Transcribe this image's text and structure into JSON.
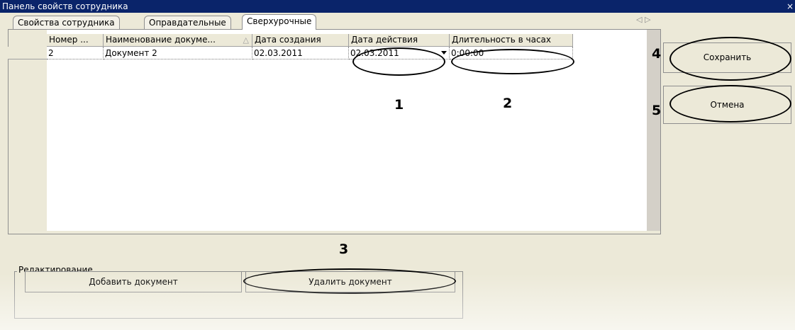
{
  "window": {
    "title": "Панель свойств сотрудника",
    "close_glyph": "×"
  },
  "tabs": [
    {
      "label": "Свойства сотрудника",
      "active": false
    },
    {
      "label": "Оправдательные",
      "active": false
    },
    {
      "label": "Сверхурочные",
      "active": true
    }
  ],
  "tab_scroll_arrows": "◁ ▷",
  "grid": {
    "columns": [
      "Номер ...",
      "Наименование докуме...",
      "Дата создания",
      "Дата действия",
      "Длительность в часах"
    ],
    "sort_indicator": "△",
    "rows": [
      [
        "2",
        "Документ 2",
        "02.03.2011",
        "02.03.2011",
        "0:00:00"
      ]
    ]
  },
  "buttons": {
    "save": "Сохранить",
    "cancel": "Отмена"
  },
  "editing": {
    "group_label": "Редактирование",
    "add_label": "Добавить документ",
    "delete_label": "Удалить документ"
  },
  "callouts": {
    "n1": "1",
    "n2": "2",
    "n3": "3",
    "n4": "4",
    "n5": "5"
  }
}
